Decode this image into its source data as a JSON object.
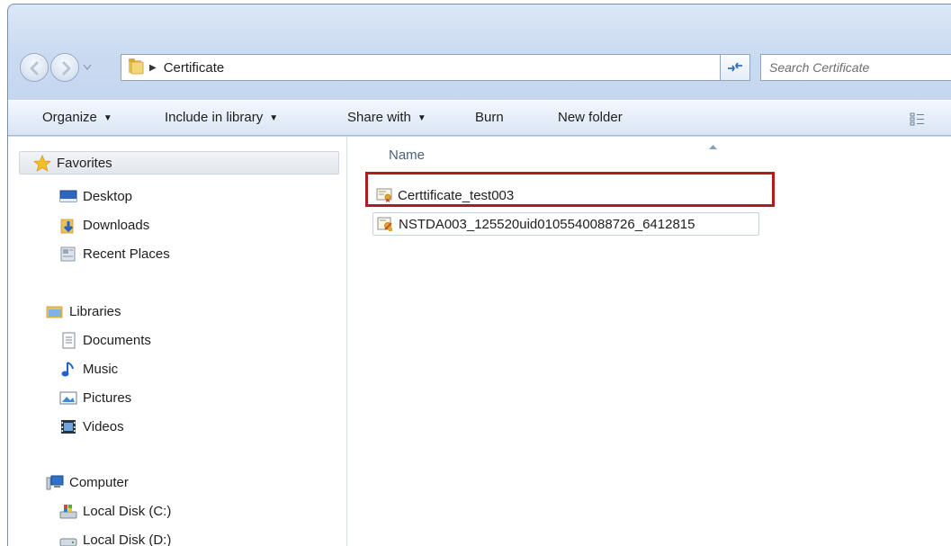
{
  "window": {
    "address": {
      "path_segments": [
        "Certificate"
      ]
    },
    "search": {
      "placeholder": "Search Certificate"
    },
    "toolbar": {
      "organize_label": "Organize",
      "include_label": "Include in library",
      "share_label": "Share with",
      "burn_label": "Burn",
      "new_folder_label": "New folder"
    },
    "nav": {
      "favorites": {
        "label": "Favorites",
        "items": [
          "Desktop",
          "Downloads",
          "Recent Places"
        ]
      },
      "libraries": {
        "label": "Libraries",
        "items": [
          "Documents",
          "Music",
          "Pictures",
          "Videos"
        ]
      },
      "computer": {
        "label": "Computer",
        "items": [
          "Local Disk (C:)",
          "Local Disk (D:)"
        ]
      }
    },
    "files": {
      "column_name": "Name",
      "rows": [
        {
          "name": "Certtificate_test003",
          "icon": "certificate-icon"
        },
        {
          "name": "NSTDA003_125520uid0105540088726_6412815",
          "icon": "personal-certificate-icon"
        }
      ]
    },
    "colors": {
      "highlight": "#b01c1c",
      "frame": "#c9daf0",
      "toolbar": "#e6eef9"
    }
  }
}
